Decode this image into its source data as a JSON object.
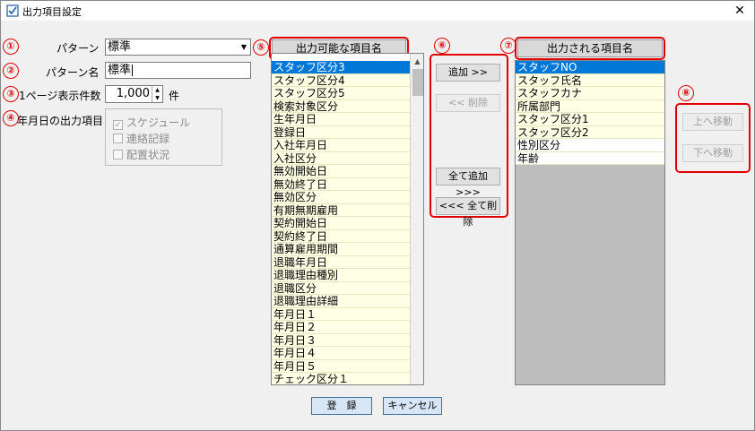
{
  "window": {
    "title": "出力項目設定",
    "close": "✕"
  },
  "markers": [
    "①",
    "②",
    "③",
    "④",
    "⑤",
    "⑥",
    "⑦",
    "⑧"
  ],
  "form": {
    "pattern_label": "パターン",
    "pattern_value": "標準",
    "pattern_name_label": "パターン名",
    "pattern_name_value": "標準",
    "page_count_label": "1ページ表示件数",
    "page_count_value": "1,000",
    "page_count_unit": "件",
    "date_output_label": "年月日の出力項目",
    "date_options": [
      {
        "label": "スケジュール",
        "checked": true
      },
      {
        "label": "連絡記録",
        "checked": false
      },
      {
        "label": "配置状況",
        "checked": false
      }
    ]
  },
  "available": {
    "header": "出力可能な項目名",
    "items": [
      "スタッフ区分3",
      "スタッフ区分4",
      "スタッフ区分5",
      "検索対象区分",
      "生年月日",
      "登録日",
      "入社年月日",
      "入社区分",
      "無効開始日",
      "無効終了日",
      "無効区分",
      "有期無期雇用",
      "契約開始日",
      "契約終了日",
      "通算雇用期間",
      "退職年月日",
      "退職理由種別",
      "退職区分",
      "退職理由詳細",
      "年月日１",
      "年月日２",
      "年月日３",
      "年月日４",
      "年月日５",
      "チェック区分１"
    ],
    "selected_index": 0
  },
  "actions": {
    "add": "追加 >>",
    "remove": "<< 削除",
    "add_all": "全て追加 >>>",
    "remove_all": "<<< 全て削除"
  },
  "output": {
    "header": "出力される項目名",
    "items": [
      "スタッフNO",
      "スタッフ氏名",
      "スタッフカナ",
      "所属部門",
      "スタッフ区分1",
      "スタッフ区分2",
      "性別区分",
      "年齢"
    ],
    "selected_index": 0
  },
  "order": {
    "up": "上へ移動",
    "down": "下へ移動"
  },
  "footer": {
    "register": "登　録",
    "cancel": "キャンセル"
  },
  "colors": {
    "marker_red": "#e00000",
    "selection_blue": "#0078d7",
    "list_yellow": "#ffffe6"
  }
}
